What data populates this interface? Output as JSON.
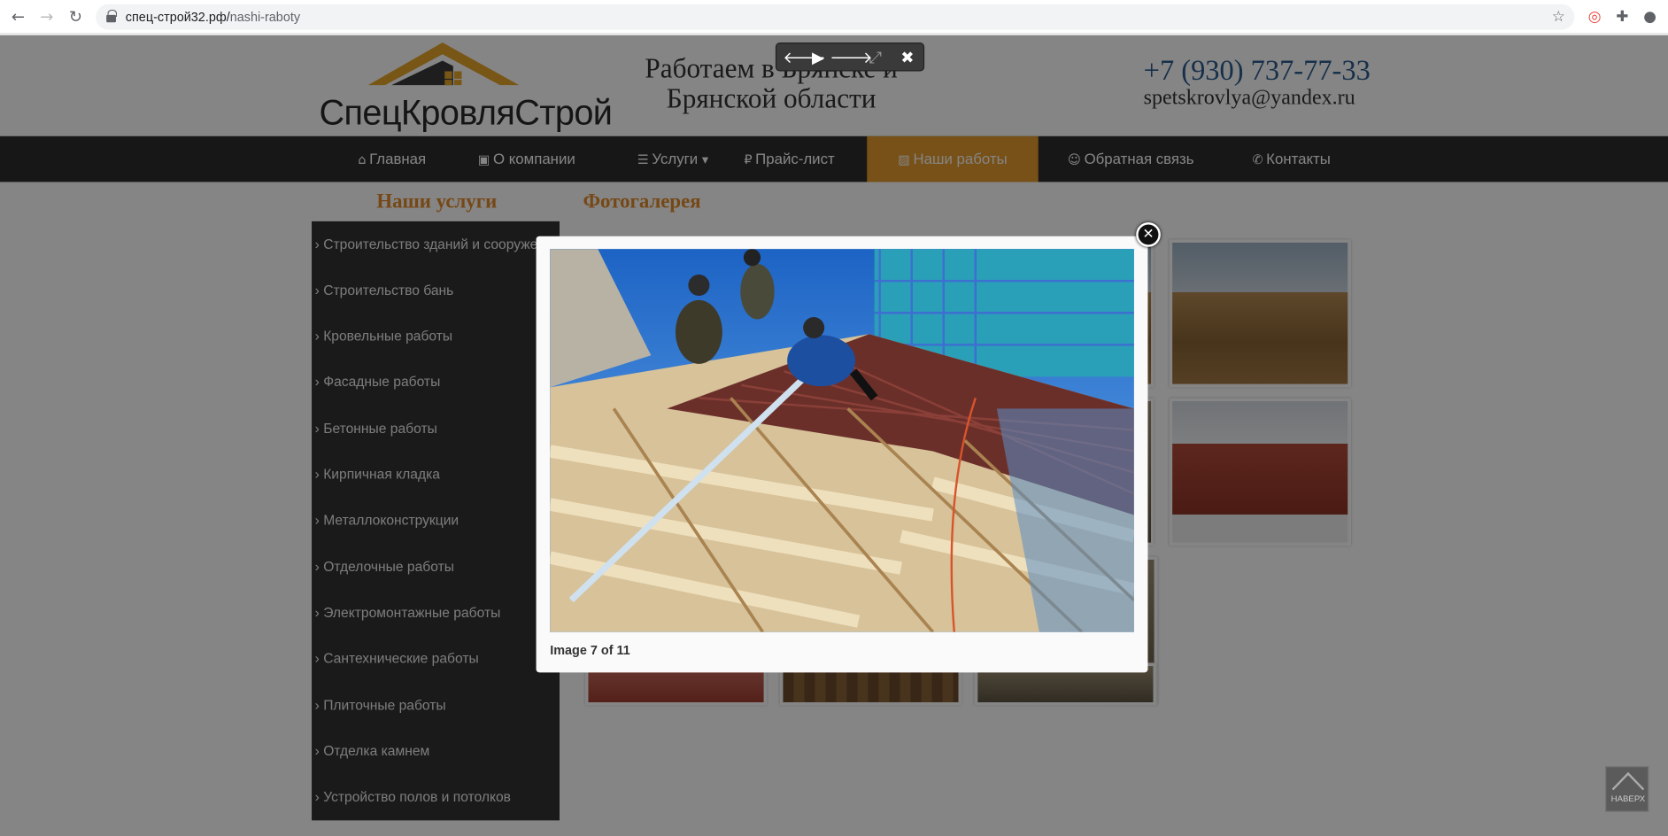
{
  "browser": {
    "url_domain": "спец-строй32.рф/",
    "url_path": "nashi-raboty"
  },
  "site": {
    "logo_text": "СпецКровляСтрой",
    "slogan": "Работаем в Брянске и Брянской области",
    "phone": "+7 (930) 737-77-33",
    "email": "spetskrovlya@yandex.ru",
    "menu": [
      {
        "icon": "home-icon",
        "glyph": "⌂",
        "label": "Главная"
      },
      {
        "icon": "briefcase-icon",
        "glyph": "▣",
        "label": "О компании"
      },
      {
        "icon": "list-icon",
        "glyph": "☰",
        "label": "Услуги",
        "caret": "▾"
      },
      {
        "icon": "ruble-icon",
        "glyph": "₽",
        "label": "Прайс-лист"
      },
      {
        "icon": "image-icon",
        "glyph": "▨",
        "label": "Наши работы"
      },
      {
        "icon": "comments-icon",
        "glyph": "☺",
        "label": "Обратная связь"
      },
      {
        "icon": "phone-icon",
        "glyph": "✆",
        "label": "Контакты"
      }
    ],
    "services_title": "Наши услуги",
    "gallery_title": "Фотогалерея",
    "services": [
      "Строительство зданий и сооружений",
      "Строительство бань",
      "Кровельные работы",
      "Фасадные работы",
      "Бетонные работы",
      "Кирпичная кладка",
      "Металлоконструкции",
      "Отделочные работы",
      "Электромонтажные работы",
      "Сантехнические работы",
      "Плиточные работы",
      "Отделка камнем",
      "Устройство полов и потолков"
    ],
    "to_top_label": "НАВЕРХ"
  },
  "lightbox": {
    "caption": "Image 7 of 11",
    "toolbar": {
      "prev": "🡐",
      "play": "▶",
      "next": "🡒",
      "fullscreen": "⤢",
      "close": "✖"
    },
    "close_glyph": "✕"
  }
}
